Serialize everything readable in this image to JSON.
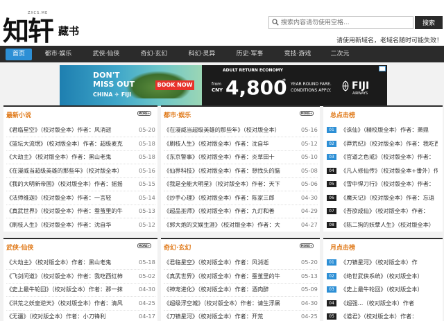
{
  "logo": {
    "main": "知轩",
    "sub": "藏书",
    "en": "ZXCS.ME"
  },
  "search": {
    "placeholder": "搜索内容请勿使用空格...",
    "button": "搜索"
  },
  "notice": "请使用新域名，老域名随时可能失效！",
  "nav": [
    "首页",
    "都市·娱乐",
    "武侠·仙侠",
    "奇幻·玄幻",
    "科幻·灵异",
    "历史·军事",
    "竞技·游戏",
    "二次元"
  ],
  "ad": {
    "line1": "DON'T",
    "line2": "MISS OUT",
    "line3": "CHINA ✈ FIJI",
    "cta": "BOOK NOW",
    "economy": "ADULT RETURN ECONOMY",
    "from": "from",
    "currency": "CNY",
    "price": "4,800",
    "asterisk": "*",
    "fare1": "YEAR ROUND FARE.",
    "fare2": "CONDITIONS APPLY.",
    "brand": "FIJI",
    "brand_sub": "AIRWAYS"
  },
  "more_label": "MORE+",
  "panels": {
    "latest": {
      "title": "最新小说",
      "rows": [
        {
          "text": "《君临星空》（校对版全本）作者：风消逝",
          "date": "05-20"
        },
        {
          "text": "《篮坛大流氓》（校对版全本）作者：超级麦克",
          "date": "05-18"
        },
        {
          "text": "《大劫主》（校对版全本）作者：黑山老鬼",
          "date": "05-18"
        },
        {
          "text": "《在漫威当超级英雄的那些年》（校对版全本）",
          "date": "05-16"
        },
        {
          "text": "《我的大明新帝国》（校对版全本）作者：摇摇",
          "date": "05-15"
        },
        {
          "text": "《法师维迦》（校对版全本）作者：一言轻",
          "date": "05-14"
        },
        {
          "text": "《真武世界》（校对版全本）作者：蚕茧里的牛",
          "date": "05-13"
        },
        {
          "text": "《刷枝人生》（校对版全本）作者：沈自华",
          "date": "05-12"
        }
      ]
    },
    "urban": {
      "title": "都市·娱乐",
      "rows": [
        {
          "text": "《在漫威当超级英雄的那些年》（校对版全本）",
          "date": "05-16"
        },
        {
          "text": "《刷枝人生》（校对版全本）作者：沈自华",
          "date": "05-12"
        },
        {
          "text": "《东京警事》（校对版全本）作者：炎草田十",
          "date": "05-10"
        },
        {
          "text": "《仙界科技》（校对版全本）作者：想找头的脑",
          "date": "05-08"
        },
        {
          "text": "《我是全能大明星》（校对版全本）作者：天下",
          "date": "05-06"
        },
        {
          "text": "《炒手心理》（校对版全本）作者：陈家三郎",
          "date": "04-30"
        },
        {
          "text": "《超品巫师》（校对版全本）作者：九灯和善",
          "date": "04-29"
        },
        {
          "text": "《郭大炮的文娱生涯》（校对版全本）作者：大",
          "date": "04-27"
        }
      ]
    },
    "hot": {
      "title": "总点击榜",
      "rows": [
        {
          "num": "01",
          "text": "《诛仙》（精校版全本）作者：萧鼎"
        },
        {
          "num": "02",
          "text": "《莽荒纪》（校对版全本）作者：我吃西"
        },
        {
          "num": "03",
          "text": "《官道之色戒》（校对版全本）作者："
        },
        {
          "num": "04",
          "text": "《凡人修仙传》（校对版全本+番外）作"
        },
        {
          "num": "05",
          "text": "《雪中悍刀行》（校对版全本）作者："
        },
        {
          "num": "06",
          "text": "《魔天记》（校对版全本）作者：忘语"
        },
        {
          "num": "07",
          "text": "《吾欲成仙》（校对版全本）作者："
        },
        {
          "num": "08",
          "text": "《陈二狗的妖孽人生》（校对版全本）"
        }
      ]
    },
    "wuxia": {
      "title": "武侠·仙侠",
      "rows": [
        {
          "text": "《大劫主》（校对版全本）作者：黑山老鬼",
          "date": "05-18"
        },
        {
          "text": "《飞剑问道》（校对版全本）作者：我吃西红柿",
          "date": "05-02"
        },
        {
          "text": "《史上最牛轮回》（校对版全本）作者：那一抹",
          "date": "04-30"
        },
        {
          "text": "《洪荒之妖皇逆天》（校对版全本）作者：清风",
          "date": "04-25"
        },
        {
          "text": "《无疆》（校对版全本）作者：小刀锋利",
          "date": "04-17"
        }
      ]
    },
    "fantasy": {
      "title": "奇幻·玄幻",
      "rows": [
        {
          "text": "《君临星空》（校对版全本）作者：风消逝",
          "date": "05-20"
        },
        {
          "text": "《真武世界》（校对版全本）作者：蚕茧里的牛",
          "date": "05-13"
        },
        {
          "text": "《神宠进化》（校对版全本）作者：酒肉醉",
          "date": "05-09"
        },
        {
          "text": "《超级浮空城》（校对版全本）作者：请生浮屠",
          "date": "04-30"
        },
        {
          "text": "《刀镇星河》（校对版全本）作者：开荒",
          "date": "04-25"
        }
      ]
    },
    "monthly": {
      "title": "月点击榜",
      "rows": [
        {
          "num": "01",
          "text": "《刀镇星河》（校对版全本）作"
        },
        {
          "num": "02",
          "text": "《绝世武侠系统》（校对版全本）"
        },
        {
          "num": "03",
          "text": "《史上最牛轮回》（校对版全本）"
        },
        {
          "num": "04",
          "text": "《超强...（校对版全本）作者"
        },
        {
          "num": "05",
          "text": "《道君》（校对版全本）作者："
        }
      ]
    }
  }
}
